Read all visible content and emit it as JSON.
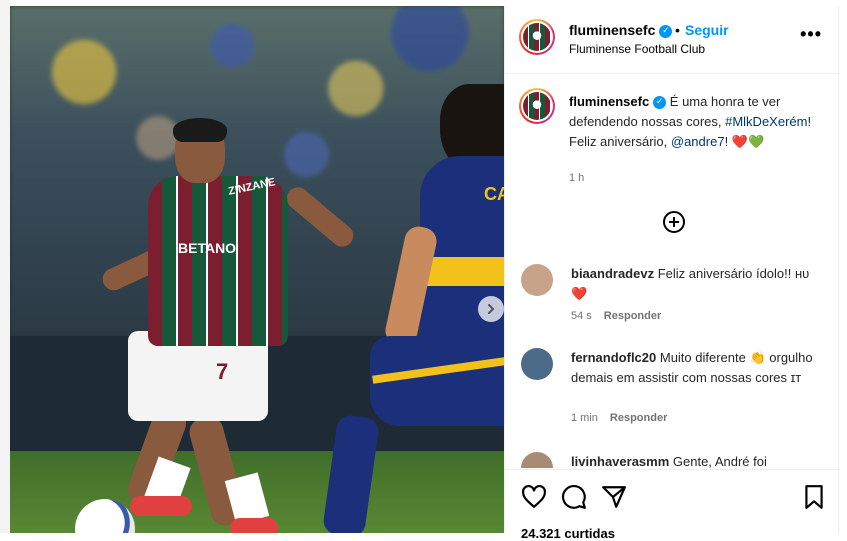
{
  "post": {
    "photo_overlay": {
      "shirt_sponsor": "BETANO",
      "shirt_top": "ZINZANE",
      "shirt_number": "7",
      "opponent_text": "CA"
    }
  },
  "header": {
    "username": "fluminensefc",
    "verified_mark": "✓",
    "dot": "•",
    "follow_label": "Seguir",
    "subtitle": "Fluminense Football Club",
    "more_label": "•••"
  },
  "caption": {
    "username": "fluminensefc",
    "text_1": " É uma honra te ver defendendo nossas cores, ",
    "hashtag": "#MlkDeXerém",
    "text_2": "! Feliz aniversário, ",
    "mention": "@andre7",
    "text_3": "! ❤️💚",
    "time": "1 h"
  },
  "comments": [
    {
      "username": "biaandradevz",
      "text": " Feliz aniversário ídolo!! ʜᴜ ❤️",
      "time": "54 s",
      "reply_label": "Responder",
      "avatar_color": "#c7a38a"
    },
    {
      "username": "fernandoflc20",
      "text": " Muito diferente 👏 orgulho demais em assistir com nossas cores ɪᴛ",
      "time": "1 min",
      "reply_label": "Responder",
      "avatar_color": "#4c6b88"
    },
    {
      "username": "livinhaverasmm",
      "text": " Gente, André foi",
      "time": "",
      "reply_label": "",
      "avatar_color": "#a88b74"
    }
  ],
  "likes": "24.321 curtidas",
  "colors": {
    "accent": "#0095f6",
    "link": "#00376b",
    "muted": "#737373"
  },
  "icons": [
    "chevron-right-icon",
    "add-circle-icon",
    "heart-icon",
    "comment-icon",
    "share-icon",
    "bookmark-icon",
    "more-icon",
    "verified-icon"
  ]
}
